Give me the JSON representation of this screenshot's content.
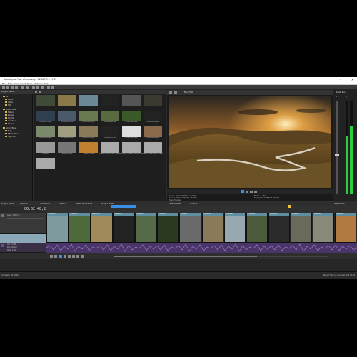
{
  "window": {
    "title": "Roadtrip on fast wheels.veg - VEGAS Pro 17.0",
    "minimize": "–",
    "maximize": "□",
    "close": "✕"
  },
  "menu": [
    "File",
    "Edit",
    "View",
    "Insert",
    "Tools",
    "Options",
    "Help"
  ],
  "explorer": {
    "header": "Project Media",
    "items": [
      {
        "label": "All"
      },
      {
        "label": "Audio"
      },
      {
        "label": "Video"
      },
      {
        "label": "Still"
      },
      {
        "label": "Media Bins"
      },
      {
        "label": "Nature"
      },
      {
        "label": "People"
      },
      {
        "label": "Sports"
      },
      {
        "label": "Locations"
      },
      {
        "label": "Travel"
      },
      {
        "label": "Smart Bins"
      },
      {
        "label": "Tags"
      },
      {
        "label": "Effect Filters"
      },
      {
        "label": "Tags Sort"
      }
    ]
  },
  "media": {
    "toolbar_label": "",
    "thumbs": [
      {
        "label": "DCIM0084.mp4",
        "color": "#3f4a38"
      },
      {
        "label": "DCIM0099.mp4",
        "color": "#8a7a4a"
      },
      {
        "label": "DCIM0110.mp4",
        "color": "#6a8a9a"
      },
      {
        "label": "DCIM0116.mp4",
        "color": "#222222"
      },
      {
        "label": "DCIM0120.mp4",
        "color": "#555555"
      },
      {
        "label": "DCIM0121.mp4",
        "color": "#3a3a30"
      },
      {
        "label": "DCIM0127.mp4",
        "color": "#2f4050"
      },
      {
        "label": "DCIM0136.mp4",
        "color": "#4a5a6a"
      },
      {
        "label": "DCIM0140.mp4",
        "color": "#6a7a50"
      },
      {
        "label": "DCIM0144.mp4",
        "color": "#5a6a40"
      },
      {
        "label": "DCIM0146.mp4",
        "color": "#3b5a2a"
      },
      {
        "label": "DCIM0150.mp4",
        "color": "#222222"
      },
      {
        "label": "DCIM0161.mp4",
        "color": "#7a8a6a"
      },
      {
        "label": "DCIM0168.mp4",
        "color": "#a0a080"
      },
      {
        "label": "DCIM0172.mp4",
        "color": "#8a7a5a"
      },
      {
        "label": "DCIM0180.mp4",
        "color": "#222222"
      },
      {
        "label": "DCIM0185.mp4",
        "color": "#dddddd"
      },
      {
        "label": "DCIM0189.mp4",
        "color": "#8a6a4a"
      },
      {
        "label": "title.png",
        "color": "#999999"
      },
      {
        "label": "sound 1.mp3",
        "color": "#777777"
      },
      {
        "label": "saved 1.mp4",
        "color": "#c08030"
      },
      {
        "label": "VEGAS Titles & Text Shadow Bottom",
        "color": "#aaaaaa"
      },
      {
        "label": "VEGAS Titles & Text Light and Shadow",
        "color": "#aaaaaa"
      },
      {
        "label": "VEGAS Titles & Text Lower Single",
        "color": "#aaaaaa"
      },
      {
        "label": "VEGAS Titles & Text Lower Left Lined",
        "color": "#aaaaaa"
      }
    ]
  },
  "preview": {
    "toolbar_label": "Best (Full)",
    "info_lines": [
      "Project: 1920x1080x32, 29.970p",
      "Preview: 1920x1080x32, 29.970p",
      "Video Preview"
    ],
    "info_right": [
      "Frame: 1,450",
      "Display: 512x288x32, 29.970"
    ]
  },
  "meter": {
    "label": "Master Bus",
    "values": [
      -3.0,
      -3.0
    ],
    "level_left": 0.62,
    "level_right": 0.74
  },
  "dock_tabs": [
    "Project Media",
    "Explorer",
    "Transitions",
    "Video FX",
    "Media Generators",
    "Project Notes",
    "Video Preview",
    "Trimmer",
    "Master Bus"
  ],
  "timeline": {
    "timecode": "00:02:48;29",
    "level_label": "Level: 100.0 %",
    "vol_label": "Vol: 0.0 dB",
    "pan_label": "Pan: Center",
    "rate_label": "Rate: 1.00",
    "video_clips": [
      {
        "title": "DCIM0084",
        "color": "#7e9a9e"
      },
      {
        "title": "DCIM0099",
        "color": "#4f6a3a"
      },
      {
        "title": "DCIM0110",
        "color": "#a08a5a"
      },
      {
        "title": "DCIM0116",
        "color": "#222"
      },
      {
        "title": "DCIM0120",
        "color": "#556b4a"
      },
      {
        "title": "DCIM0121",
        "color": "#2a3a20"
      },
      {
        "title": "DCIM0127",
        "color": "#6a6a6a"
      },
      {
        "title": "DCIM0136",
        "color": "#8a7a5a"
      },
      {
        "title": "DCIM0140",
        "color": "#98a8b0"
      },
      {
        "title": "DCIM0144",
        "color": "#4a5a3a"
      },
      {
        "title": "DCIM0150",
        "color": "#2b2b2b"
      },
      {
        "title": "DCIM0161",
        "color": "#6a6a5a"
      },
      {
        "title": "DCIM0168",
        "color": "#8a8a7a"
      },
      {
        "title": "DCIM0185",
        "color": "#b07a40"
      }
    ]
  },
  "status": {
    "left": "Complete: 00:00:00",
    "right": "Record Time (2 channels): 123:40:45"
  },
  "colors": {
    "accent": "#3a8ee6",
    "audio_track": "#6a4a9a",
    "meter_green": "#2ecc40"
  }
}
